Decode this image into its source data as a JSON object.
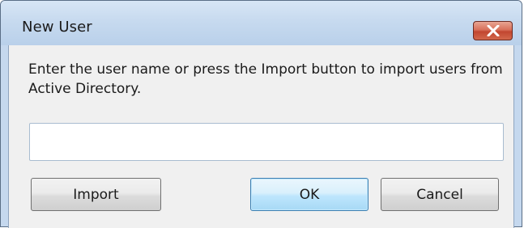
{
  "window": {
    "title": "New User"
  },
  "dialog": {
    "prompt": "Enter the user name or press the Import button to import users from Active Directory.",
    "user_name_value": "",
    "buttons": {
      "import": "Import",
      "ok": "OK",
      "cancel": "Cancel"
    }
  },
  "icons": {
    "close": "close-icon"
  },
  "colors": {
    "title_bar": "#c7daef",
    "close_button": "#c24630",
    "client_background": "#f0f0f0",
    "default_button_border": "#3c7fb1"
  }
}
